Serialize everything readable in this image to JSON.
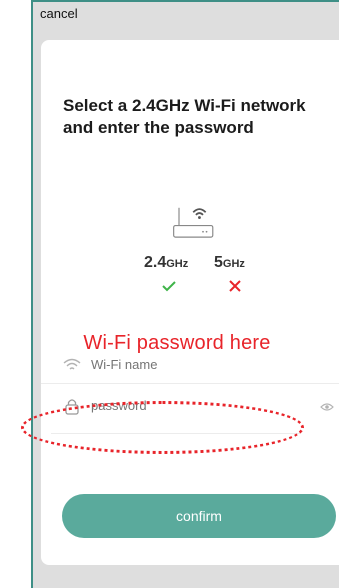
{
  "header": {
    "cancel_label": "cancel"
  },
  "title": "Select a 2.4GHz Wi-Fi network and enter the password",
  "bands": [
    {
      "number": "2.4",
      "unit": "GHz",
      "status": "supported"
    },
    {
      "number": "5",
      "unit": "GHz",
      "status": "not-supported"
    }
  ],
  "annotation": "Wi-Fi password here",
  "form": {
    "wifi_name_placeholder": "Wi-Fi name",
    "password_placeholder": "password"
  },
  "confirm_label": "confirm",
  "colors": {
    "accent": "#5aaa9c",
    "check": "#3fb449",
    "cross": "#e8242a",
    "annotation": "#e8242a",
    "frame": "#3e8f86"
  },
  "icons": [
    "router-icon",
    "check-icon",
    "x-icon",
    "wifi-icon",
    "lock-icon",
    "eye-icon"
  ]
}
